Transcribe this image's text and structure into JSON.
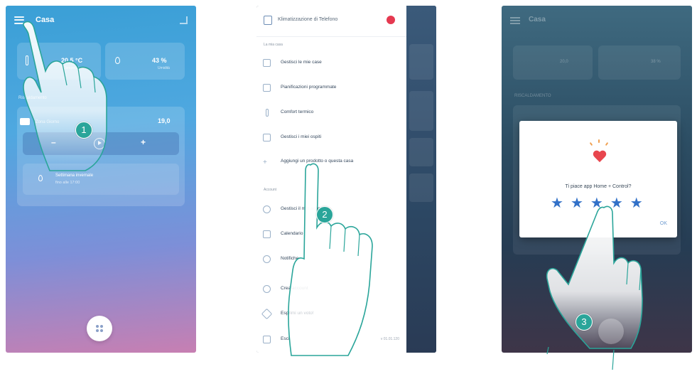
{
  "panel1": {
    "title": "Casa",
    "temp_value": "20,5 °C",
    "temp_sub": "Temperatura",
    "humidity_value": "43 %",
    "humidity_sub": "Umidità",
    "section_label": "Riscaldamento",
    "zone_label": "Zona Giorno",
    "setpoint": "19,0",
    "minus": "–",
    "plus": "+",
    "schedule_text": "Settimana invernale",
    "schedule_sub": "fino alle 17:00"
  },
  "panel2": {
    "user": "Klimatizzazione di Telefono",
    "section_home": "La mia casa",
    "items": [
      "Gestisci le mie case",
      "Pianificazioni programmate",
      "Comfort termico",
      "Gestisci i miei ospiti",
      "Aggiungi un prodotto o questa casa"
    ],
    "section_account": "Account",
    "items2": [
      "Gestisci il mio account",
      "Calendario",
      "Notifiche",
      "Crea account",
      "Esprimi un voto!",
      "Esci"
    ],
    "version": "v 01.01.120"
  },
  "panel3": {
    "title": "Casa",
    "temp_value": "20,0",
    "humidity_value": "38 %",
    "section_label": "RISCALDAMENTO",
    "dialog_question": "Ti piace app Home + Control?",
    "stars": [
      "★",
      "★",
      "★",
      "★",
      "★"
    ],
    "ok": "OK"
  },
  "steps": [
    "1",
    "2",
    "3"
  ],
  "colors": {
    "step_badge": "#2aa59a",
    "star": "#3271c8",
    "heart": "#e8464e",
    "notification_badge": "#e53950"
  }
}
